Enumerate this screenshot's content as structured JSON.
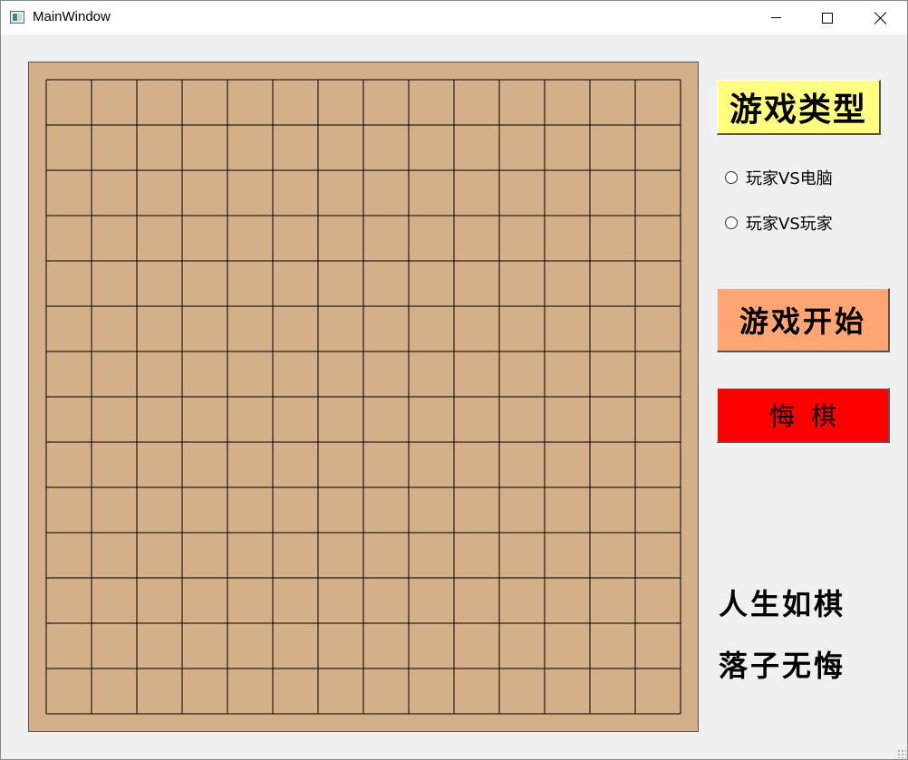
{
  "window": {
    "title": "MainWindow"
  },
  "board": {
    "rows": 14,
    "cols": 14,
    "background": "#d3af8a",
    "line_color": "#000000"
  },
  "sidebar": {
    "game_type_label": "游戏类型",
    "mode_options": [
      {
        "label": "玩家VS电脑",
        "selected": false
      },
      {
        "label": "玩家VS玩家",
        "selected": false
      }
    ],
    "start_button_label": "游戏开始",
    "undo_button_label": "悔  棋",
    "motto_line1": "人生如棋",
    "motto_line2": "落子无悔"
  },
  "colors": {
    "game_type_bg": "#ffff80",
    "start_button_bg": "#ffa574",
    "undo_button_bg": "#ff0000"
  }
}
